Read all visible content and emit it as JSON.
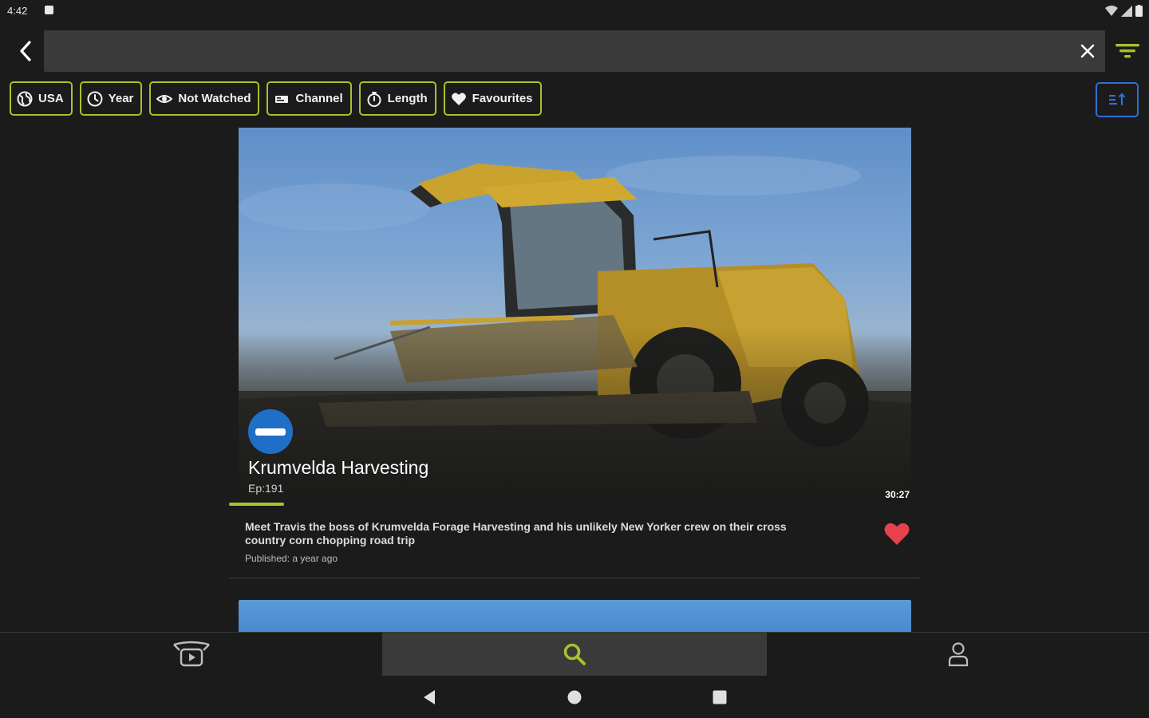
{
  "status_bar": {
    "time": "4:42"
  },
  "search": {
    "value": "",
    "placeholder": ""
  },
  "filters": [
    {
      "label": "USA",
      "icon": "globe-icon"
    },
    {
      "label": "Year",
      "icon": "clock-icon"
    },
    {
      "label": "Not Watched",
      "icon": "eye-icon"
    },
    {
      "label": "Channel",
      "icon": "channel-icon"
    },
    {
      "label": "Length",
      "icon": "stopwatch-icon"
    },
    {
      "label": "Favourites",
      "icon": "heart-icon"
    }
  ],
  "video": {
    "title": "Krumvelda Harvesting",
    "episode": "Ep:191",
    "duration": "30:27",
    "watched_progress": 0.08,
    "description": "Meet Travis the boss of Krumvelda Forage Harvesting and his unlikely New Yorker crew on their cross country corn chopping road trip",
    "published": "Published: a year ago",
    "favourite": true
  },
  "bottom_nav": [
    {
      "name": "videos",
      "icon": "tv-play-icon",
      "active": false
    },
    {
      "name": "search",
      "icon": "search-icon",
      "active": true
    },
    {
      "name": "profile",
      "icon": "person-icon",
      "active": false
    }
  ],
  "colors": {
    "accent": "#a7c22a",
    "sort_border": "#2f6fd6",
    "favourite": "#e8414e",
    "background": "#1b1b1b"
  }
}
